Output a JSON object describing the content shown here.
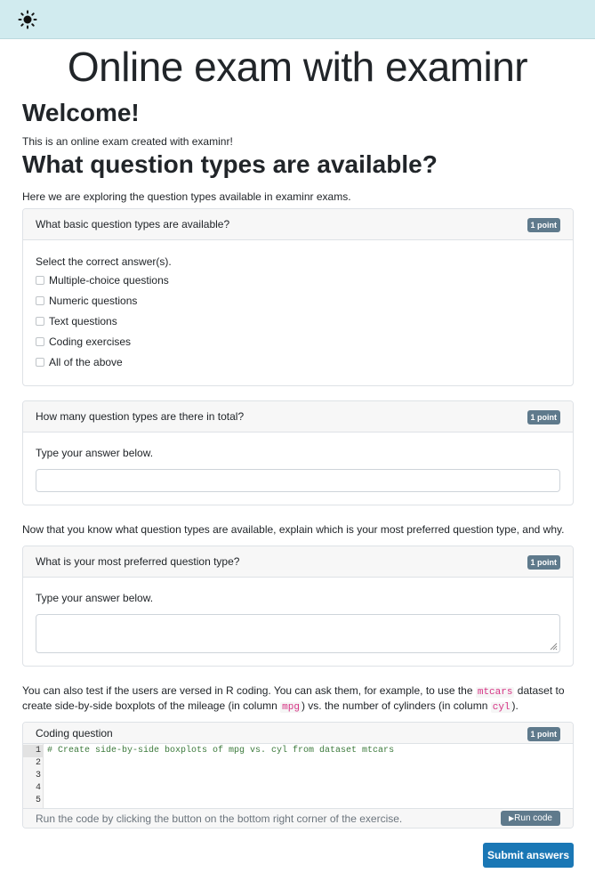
{
  "header": {
    "theme_icon": "sun-icon"
  },
  "page": {
    "title": "Online exam with examinr",
    "welcome_heading": "Welcome!",
    "welcome_text": "This is an online exam created with examinr!",
    "qtypes_heading": "What question types are available?",
    "qtypes_intro": "Here we are exploring the question types available in examinr exams.",
    "between_text": "Now that you know what question types are available, explain which is your most preferred question type, and why.",
    "coding_intro": {
      "line1_a": "You can also test if the users are versed in R coding. You can ask them, for example, to use the ",
      "line1_code": "mtcars",
      "line1_b": " dataset to",
      "line2_a": "create side-by-side boxplots of the mileage (in column ",
      "line2_code1": "mpg",
      "line2_b": ") vs. the number of cylinders (in column ",
      "line2_code2": "cyl",
      "line2_c": ")."
    }
  },
  "questions": [
    {
      "title": "What basic question types are available?",
      "points": "1 point",
      "prompt": "Select the correct answer(s).",
      "options": [
        "Multiple-choice questions",
        "Numeric questions",
        "Text questions",
        "Coding exercises",
        "All of the above"
      ]
    },
    {
      "title": "How many question types are there in total?",
      "points": "1 point",
      "prompt": "Type your answer below.",
      "value": ""
    },
    {
      "title": "What is your most preferred question type?",
      "points": "1 point",
      "prompt": "Type your answer below.",
      "value": ""
    },
    {
      "title": "Coding question",
      "points": "1 point",
      "line_numbers": [
        "1",
        "2",
        "3",
        "4",
        "5"
      ],
      "code": "# Create side-by-side boxplots of mpg vs. cyl from dataset mtcars",
      "hint": "Run the code by clicking the button on the bottom right corner of the exercise.",
      "run_label": "Run code"
    }
  ],
  "submit_label": "Submit answers",
  "colors": {
    "topbar": "#d1ebef",
    "badge": "#5f7a8c",
    "submit": "#1a77b5",
    "code_comment": "#3c7a3c",
    "inline_code": "#d63384"
  }
}
